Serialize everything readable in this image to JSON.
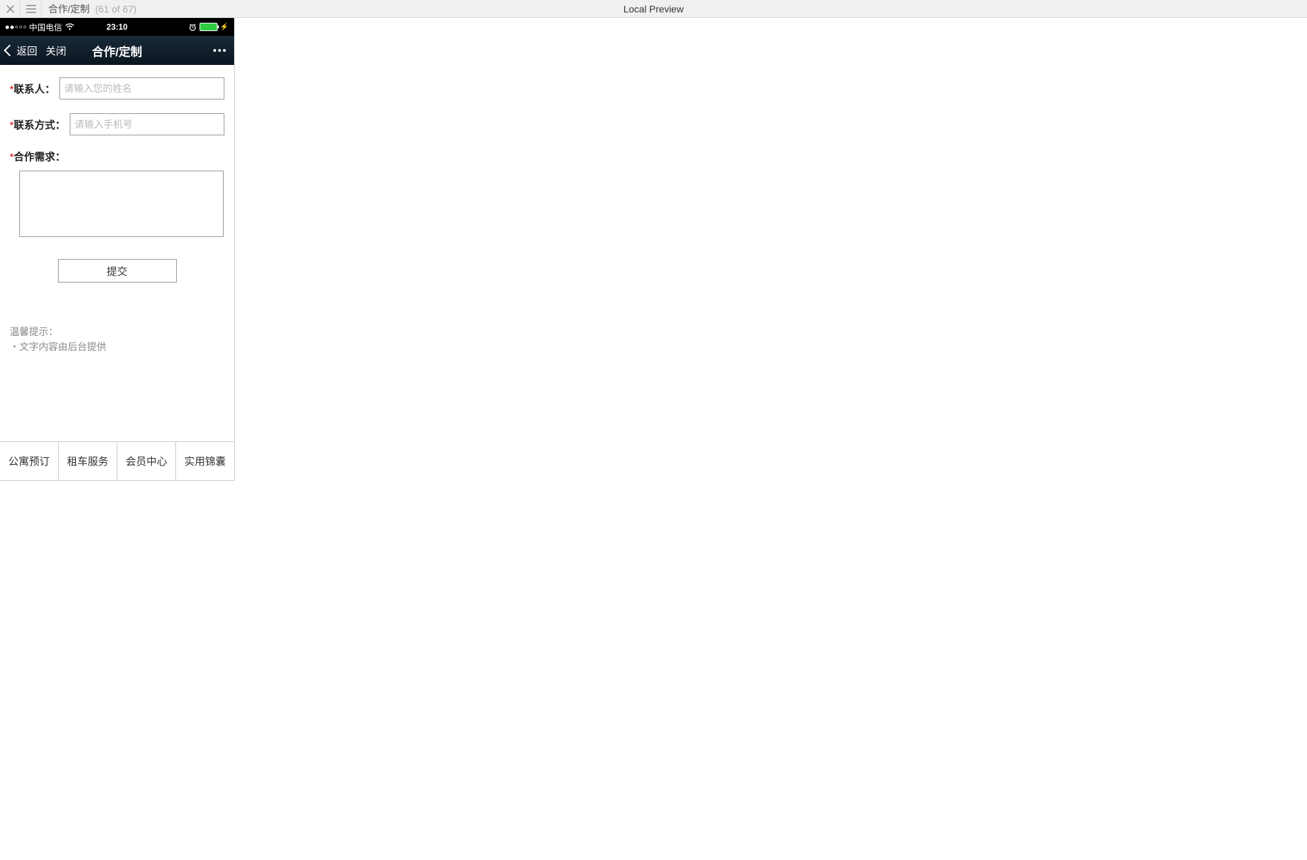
{
  "toolbar": {
    "title": "合作/定制",
    "counter": "(61 of 67)",
    "center_label": "Local Preview"
  },
  "status_bar": {
    "carrier": "中国电信",
    "time": "23:10"
  },
  "app_nav": {
    "back_label": "返回",
    "close_label": "关闭",
    "title": "合作/定制"
  },
  "form": {
    "contact_label": "联系人：",
    "contact_placeholder": "请输入您的姓名",
    "phone_label": "联系方式：",
    "phone_placeholder": "请输入手机号",
    "need_label": "合作需求：",
    "submit_label": "提交"
  },
  "tips": {
    "title": "温馨提示：",
    "line1": "・文字内容由后台提供"
  },
  "tabs": {
    "items": [
      "公寓预订",
      "租车服务",
      "会员中心",
      "实用锦囊"
    ]
  }
}
